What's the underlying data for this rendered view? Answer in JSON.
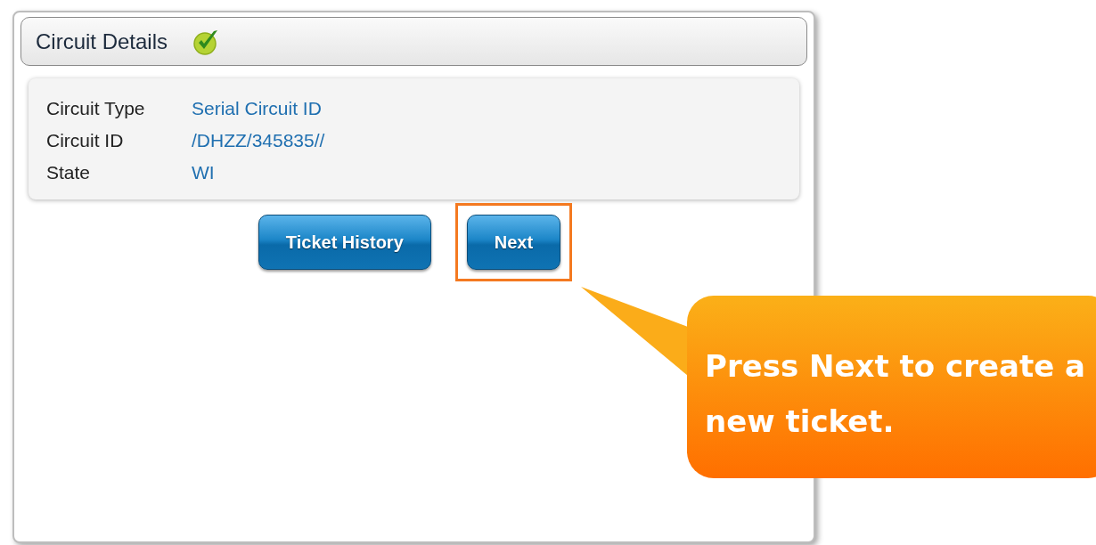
{
  "panel": {
    "title": "Circuit Details",
    "complete": true
  },
  "details": [
    {
      "label": "Circuit Type",
      "value": "Serial Circuit ID"
    },
    {
      "label": "Circuit ID",
      "value": "/DHZZ/345835//"
    },
    {
      "label": "State",
      "value": "WI"
    }
  ],
  "buttons": [
    {
      "label": "Ticket History",
      "highlighted": false
    },
    {
      "label": "Next",
      "highlighted": true
    }
  ],
  "callout": {
    "text": "Press Next to create a new ticket."
  }
}
